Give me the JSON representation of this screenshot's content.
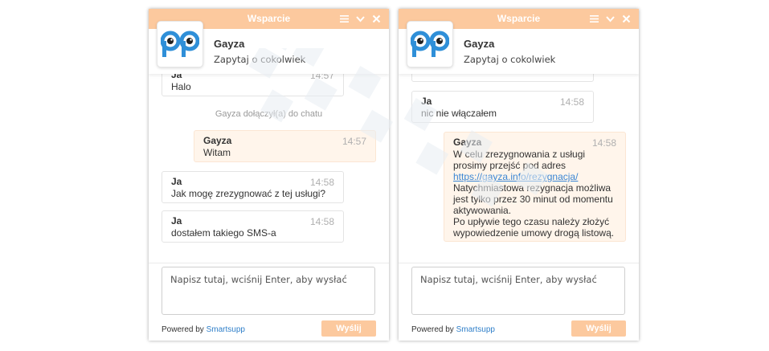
{
  "widgets": [
    {
      "title": "Wsparcie",
      "agent": {
        "name": "Gayza",
        "subtitle": "Zapytaj o cokolwiek"
      },
      "messages": [
        {
          "type": "visitor",
          "sender": "Ja",
          "text": [
            "Halo"
          ],
          "time": "14:57"
        },
        {
          "type": "system",
          "text": "Gayza dołączył(a) do chatu"
        },
        {
          "type": "agent",
          "sender": "Gayza",
          "text": [
            "Witam"
          ],
          "time": "14:57"
        },
        {
          "type": "visitor",
          "sender": "Ja",
          "text": [
            "Jak mogę zrezygnować z tej usługi?"
          ],
          "time": "14:58"
        },
        {
          "type": "visitor",
          "sender": "Ja",
          "text": [
            "dostałem takiego SMS-a"
          ],
          "time": "14:58"
        }
      ],
      "composer_placeholder": "Napisz tutaj, wciśnij Enter, aby wysłać",
      "powered_prefix": "Powered by",
      "powered_brand": "Smartsupp",
      "send_label": "Wyślij"
    },
    {
      "title": "Wsparcie",
      "agent": {
        "name": "Gayza",
        "subtitle": "Zapytaj o cokolwiek"
      },
      "messages": [
        {
          "type": "visitor",
          "sender": "Ja",
          "text": [
            "nic nie włączałem"
          ],
          "time": "14:58"
        },
        {
          "type": "agent",
          "sender": "Gayza",
          "time": "14:58",
          "text": [
            "W celu zrezygnowania z usługi",
            "prosimy przejść pod adres"
          ],
          "link": "https://gayza.info/rezygnacja/",
          "text_after": [
            "Natychmiastowa rezygnacja możliwa",
            "jest tylko przez 30 minut od momentu",
            "aktywowania.",
            "Po upływie tego czasu należy złożyć",
            "wypowiedzenie umowy drogą listową."
          ]
        }
      ],
      "composer_placeholder": "Napisz tutaj, wciśnij Enter, aby wysłać",
      "powered_prefix": "Powered by",
      "powered_brand": "Smartsupp",
      "send_label": "Wyślij"
    }
  ],
  "theme": {
    "accent": "#fcc99e",
    "agent_bubble": "#fff5eb",
    "link": "#3b86d4",
    "logo_blue": "#2f8fd8"
  },
  "icons": [
    "menu-icon",
    "minimize-icon",
    "close-icon",
    "agent-avatar-logo"
  ]
}
